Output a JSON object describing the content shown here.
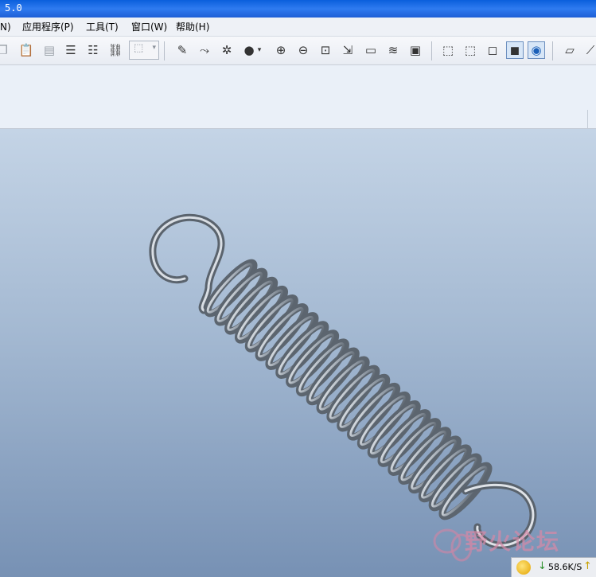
{
  "window": {
    "title": "5.0"
  },
  "menu": {
    "items": [
      {
        "label": "N)"
      },
      {
        "label": "应用程序(P)"
      },
      {
        "label": "工具(T)"
      },
      {
        "label": "窗口(W)"
      },
      {
        "label": "帮助(H)"
      }
    ]
  },
  "toolbar": {
    "icons": [
      "copy-icon",
      "paste-icon",
      "paste-special-icon",
      "regenerate-icon",
      "regenerate-manager-icon",
      "find-icon",
      "select-box-icon",
      "sketch-icon",
      "datum-curve-icon",
      "spin-center-icon",
      "shade-sphere-icon",
      "zoom-in-icon",
      "zoom-out-icon",
      "refit-icon",
      "reorient-icon",
      "view-label-icon",
      "layers-icon",
      "saved-views-icon",
      "wireframe-icon",
      "hidden-line-icon",
      "no-hidden-icon",
      "shading-icon",
      "enhanced-realism-icon",
      "datum-plane-icon",
      "datum-axis-icon"
    ]
  },
  "viewport": {
    "model": "extension-spring",
    "background_top": "#c4d4e6",
    "background_bottom": "#7791b4"
  },
  "watermark": {
    "text": "野火论坛"
  },
  "status": {
    "download_speed": "58.6K/S"
  }
}
